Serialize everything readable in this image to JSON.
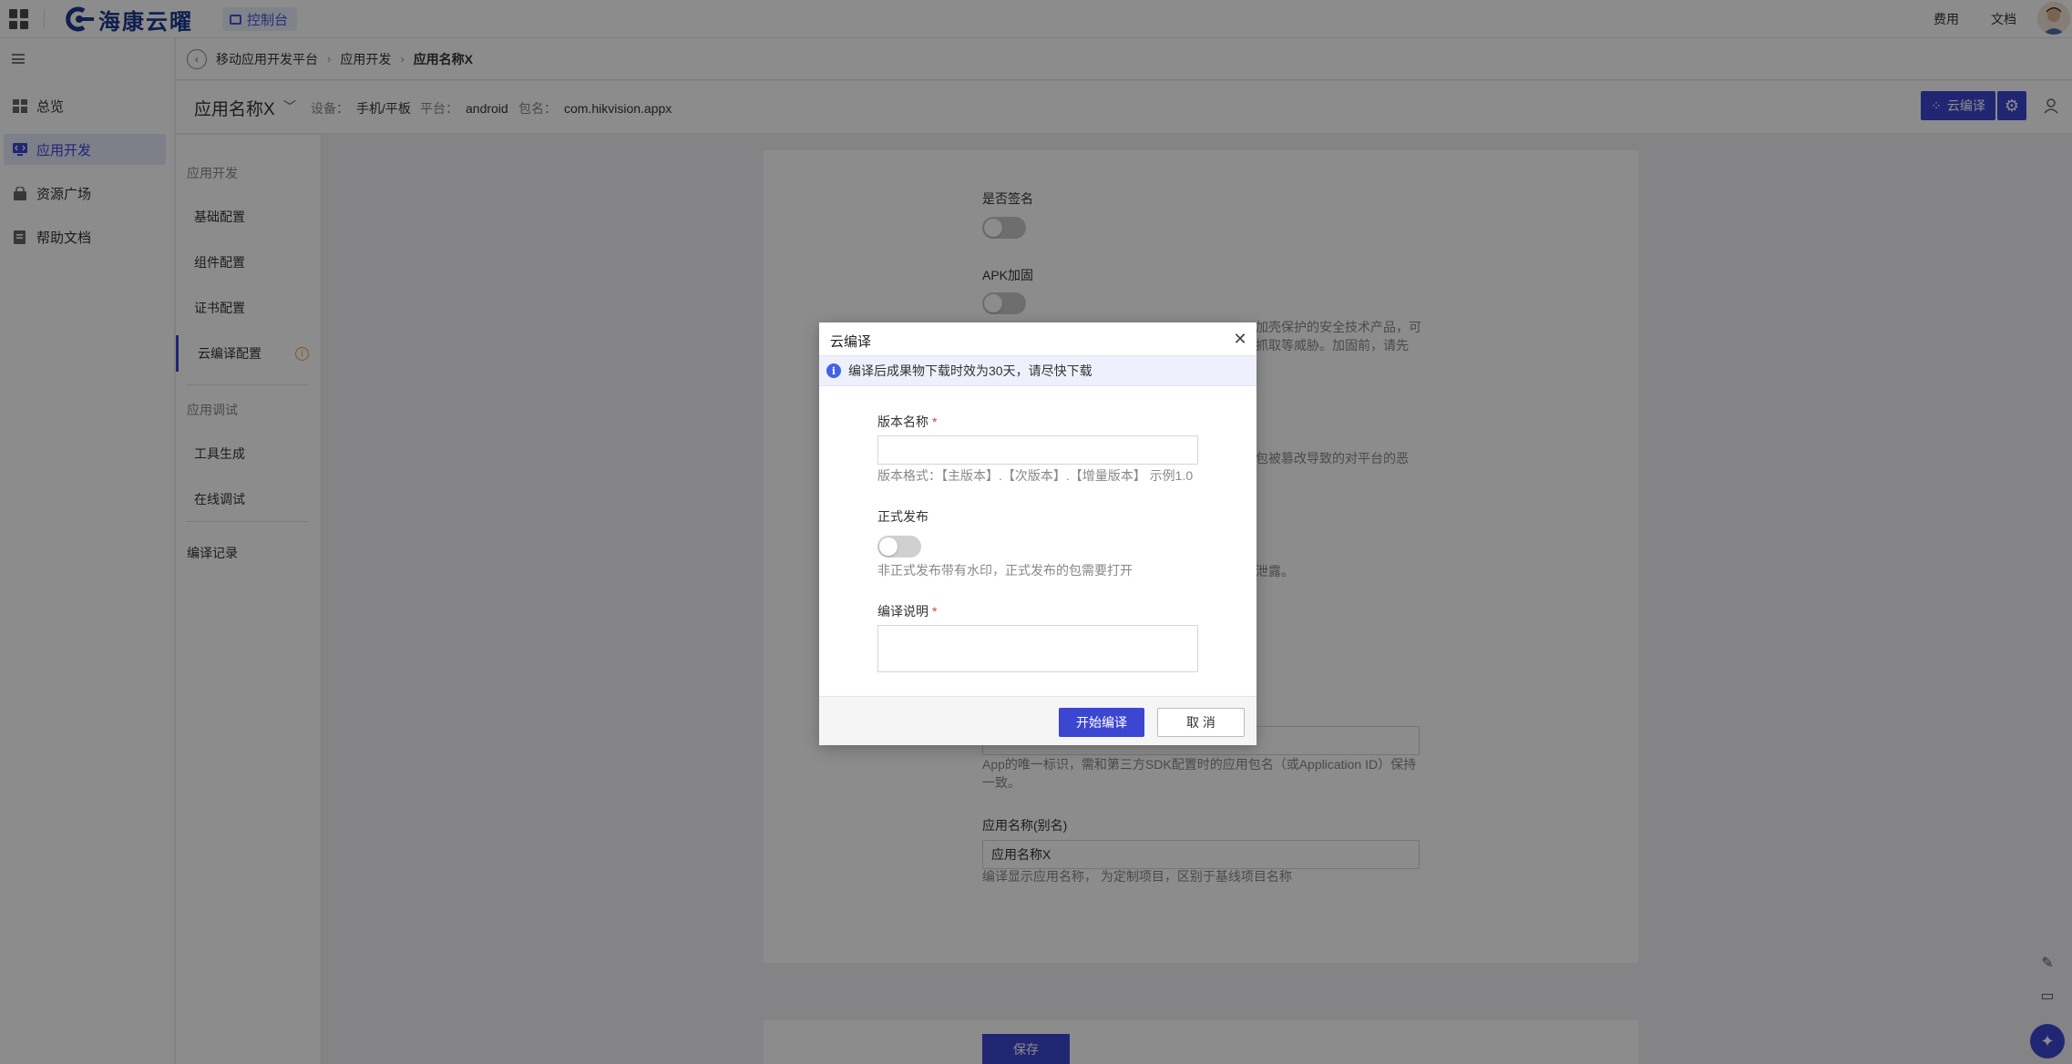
{
  "topbar": {
    "brand": "海康云曜",
    "console_label": "控制台",
    "links": [
      "费用",
      "文档"
    ]
  },
  "sidebar": {
    "items": [
      {
        "label": "总览",
        "icon": "dashboard-icon"
      },
      {
        "label": "应用开发",
        "icon": "app-dev-icon",
        "active": true
      },
      {
        "label": "资源广场",
        "icon": "bag-icon"
      },
      {
        "label": "帮助文档",
        "icon": "doc-icon"
      }
    ]
  },
  "breadcrumb": [
    "移动应用开发平台",
    "应用开发",
    "应用名称X"
  ],
  "app_header": {
    "name": "应用名称X",
    "device_label": "设备：",
    "device_value": "手机/平板",
    "platform_label": "平台：",
    "platform_value": "android",
    "package_label": "包名：",
    "package_value": "com.hikvision.appx",
    "cloud_build_label": "云编译"
  },
  "subnav": {
    "group1": "应用开发",
    "items1": [
      "基础配置",
      "组件配置",
      "证书配置",
      "云编译配置"
    ],
    "group2": "应用调试",
    "items2": [
      "工具生成",
      "在线调试"
    ],
    "build_records": "编译记录"
  },
  "content": {
    "sign_label": "是否签名",
    "apk_label": "APK加固",
    "apk_help_1": "加壳保护的安全技术产品，可",
    "apk_help_2": "抓取等威胁。加固前，请先",
    "tamper_help": "包被篡改导致的对平台的恶",
    "leak_help": "泄露。",
    "package_help": "App的唯一标识，需和第三方SDK配置时的应用包名（或Application ID）保持一致。",
    "alias_label": "应用名称(别名)",
    "alias_value": "应用名称X",
    "alias_help": "编译显示应用名称， 为定制项目，区别于基线项目名称",
    "save_label": "保存"
  },
  "dialog": {
    "title": "云编译",
    "notice": "编译后成果物下载时效为30天，请尽快下载",
    "version_label": "版本名称",
    "version_placeholder": "",
    "version_help": "版本格式：【主版本】.【次版本】.【增量版本】 示例1.0",
    "release_label": "正式发布",
    "release_help": "非正式发布带有水印，正式发布的包需要打开",
    "desc_label": "编译说明",
    "start_label": "开始编译",
    "cancel_label": "取 消"
  }
}
